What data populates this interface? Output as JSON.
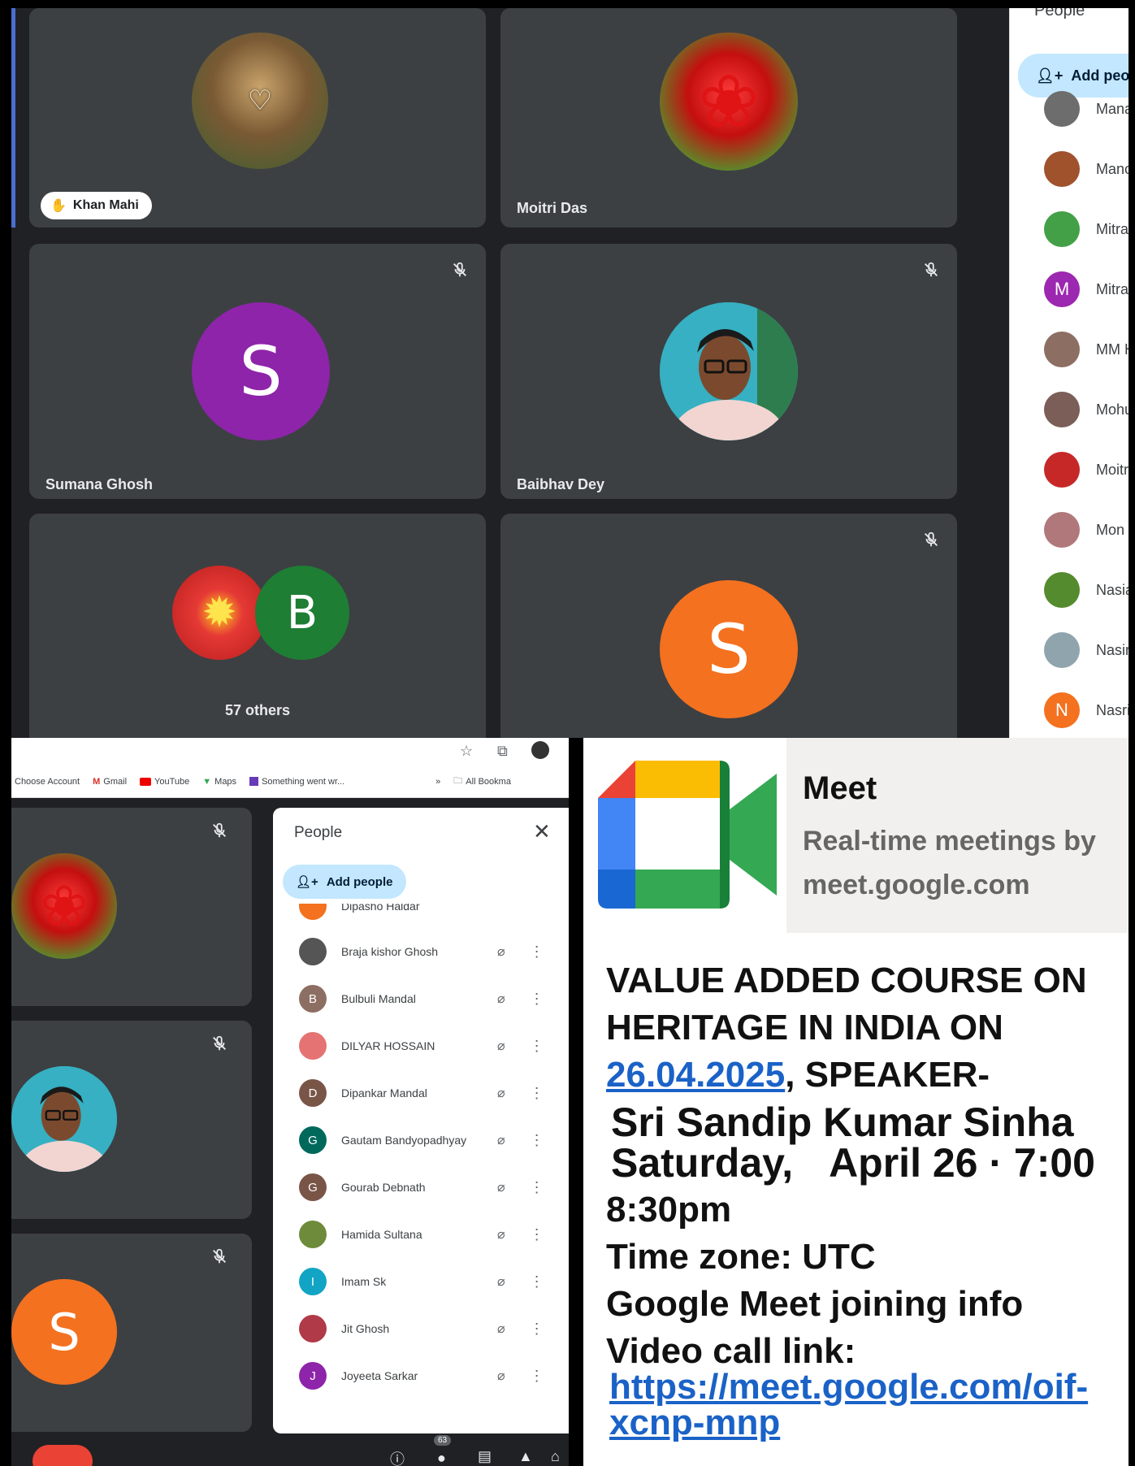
{
  "top_panel": {
    "tiles": [
      {
        "name": "Khan Mahi",
        "avatar": "heart-wreath-photo",
        "raised_hand": true
      },
      {
        "name": "Moitri Das",
        "avatar": "red-rose-photo"
      },
      {
        "name": "Sumana Ghosh",
        "avatar_letter": "S",
        "avatar_color": "#8e24aa",
        "muted": true
      },
      {
        "name": "Baibhav Dey",
        "avatar": "portrait-photo",
        "muted": true
      },
      {
        "group_label": "57 others",
        "avatar_letter": "B",
        "avatar_color": "#1e7e34"
      },
      {
        "avatar_letter": "S",
        "avatar_color": "#f4711f",
        "muted": true
      }
    ],
    "people_panel": {
      "title": "People",
      "add_people_label": "Add peop",
      "list": [
        {
          "name": "Manas",
          "avatar_color": "#6d6d6d"
        },
        {
          "name": "Manoj",
          "avatar_color": "#a0522d"
        },
        {
          "name": "Mitra I",
          "avatar_color": "#43a047"
        },
        {
          "name": "Mitra I",
          "letter": "M",
          "avatar_color": "#9c27b0"
        },
        {
          "name": "MM Ha",
          "avatar_color": "#8d6e63"
        },
        {
          "name": "Mohua",
          "avatar_color": "#7b5e57"
        },
        {
          "name": "Moitri",
          "avatar_color": "#c62828"
        },
        {
          "name": "Mon H",
          "avatar_color": "#b0787a"
        },
        {
          "name": "Nasiar",
          "avatar_color": "#558b2f"
        },
        {
          "name": "Nasir A",
          "avatar_color": "#90a4ae"
        },
        {
          "name": "Nasrin",
          "letter": "N",
          "avatar_color": "#f4711f"
        }
      ]
    }
  },
  "bottom_left": {
    "browser": {
      "bookmarks": [
        {
          "label": "Choose Account",
          "icon": "none"
        },
        {
          "label": "Gmail",
          "icon": "gmail-icon"
        },
        {
          "label": "YouTube",
          "icon": "youtube-icon"
        },
        {
          "label": "Maps",
          "icon": "maps-pin-icon"
        },
        {
          "label": "Something went wr...",
          "icon": "sheets-icon"
        }
      ],
      "overflow": "»",
      "all_bookmarks": "All Bookma"
    },
    "people_panel": {
      "title": "People",
      "add_people_label": "Add people",
      "clipped_name": "Dipasho Haldar",
      "list": [
        {
          "name": "Braja kishor Ghosh",
          "avatar_color": "#555555"
        },
        {
          "name": "Bulbuli Mandal",
          "letter": "B",
          "avatar_color": "#8d6e63"
        },
        {
          "name": "DILYAR HOSSAIN",
          "avatar_color": "#e57373"
        },
        {
          "name": "Dipankar Mandal",
          "letter": "D",
          "avatar_color": "#795548"
        },
        {
          "name": "Gautam Bandyopadhyay",
          "letter": "G",
          "avatar_color": "#00695c"
        },
        {
          "name": "Gourab Debnath",
          "letter": "G",
          "avatar_color": "#795548"
        },
        {
          "name": "Hamida Sultana",
          "avatar_color": "#6d8b3a"
        },
        {
          "name": "Imam Sk",
          "letter": "I",
          "avatar_color": "#12a4c4"
        },
        {
          "name": "Jit Ghosh",
          "avatar_color": "#b03a48"
        },
        {
          "name": "Joyeeta Sarkar",
          "letter": "J",
          "avatar_color": "#8e24aa"
        }
      ]
    },
    "participant_count": "63"
  },
  "bottom_right": {
    "preview": {
      "app_name": "Meet",
      "description": "Real-time meetings by",
      "domain": "meet.google.com"
    },
    "message": {
      "line1": "VALUE ADDED COURSE ON",
      "line2": "HERITAGE IN INDIA ON",
      "date": "26.04.2025",
      "line3_rest": ", SPEAKER-",
      "speaker": "Sri Sandip Kumar Sinha",
      "day": "Saturday,",
      "date_time": "April  26 · 7:00",
      "end_time": "8:30pm",
      "timezone": "Time zone: UTC",
      "join_info": "Google Meet joining info",
      "video_label": "Video call link:",
      "link_part1": "https://meet.google.com/oif-",
      "link_part2": "xcnp-mnp"
    }
  }
}
